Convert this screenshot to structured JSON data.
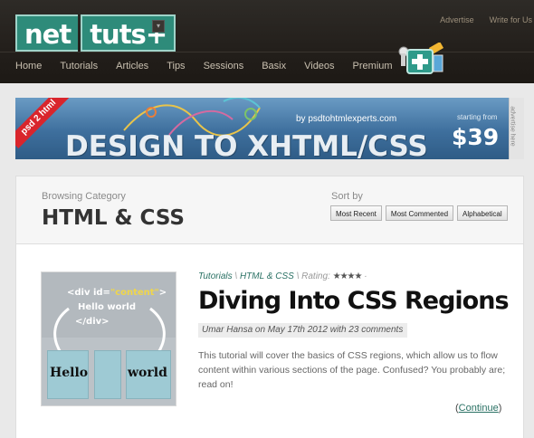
{
  "header": {
    "logo_left": "net",
    "logo_right": "tuts+",
    "top_links": [
      "Advertise",
      "Write for Us"
    ],
    "nav": [
      "Home",
      "Tutorials",
      "Articles",
      "Tips",
      "Sessions",
      "Basix",
      "Videos",
      "Premium"
    ]
  },
  "banner": {
    "ribbon": "psd 2 html",
    "by": "by psdtohtmlexperts.com",
    "headline": "DESIGN TO XHTML/CSS",
    "starting": "starting from",
    "price": "$39",
    "side_label": "advertise here"
  },
  "category": {
    "label": "Browsing Category",
    "title": "HTML & CSS",
    "sort_label": "Sort by",
    "sort_options": [
      "Most Recent",
      "Most Commented",
      "Alphabetical"
    ]
  },
  "article": {
    "crumb_1": "Tutorials",
    "crumb_2": "HTML & CSS",
    "sep": "\\",
    "rating_label": "Rating:",
    "rating_stars": "★★★★",
    "rating_rest": "·",
    "rating_value": 4,
    "title": "Diving Into CSS Regions",
    "byline": "Umar Hansa on May 17th 2012 with 23 comments",
    "excerpt": "This tutorial will cover the basics of CSS regions, which allow us to flow content within various sections of the page. Confused? You probably are; read on!",
    "continue_label": "Continue",
    "thumb": {
      "code_open_a": "<div id=",
      "code_open_b": "\"content\"",
      "code_open_c": ">",
      "hello": "Hello world",
      "code_close": "</div>",
      "word_left": "Hello",
      "word_right": "world"
    }
  },
  "colors": {
    "accent": "#2a7164",
    "logo": "#2e8b7a",
    "header_bg": "#231f1b",
    "ribbon": "#d9252c"
  }
}
